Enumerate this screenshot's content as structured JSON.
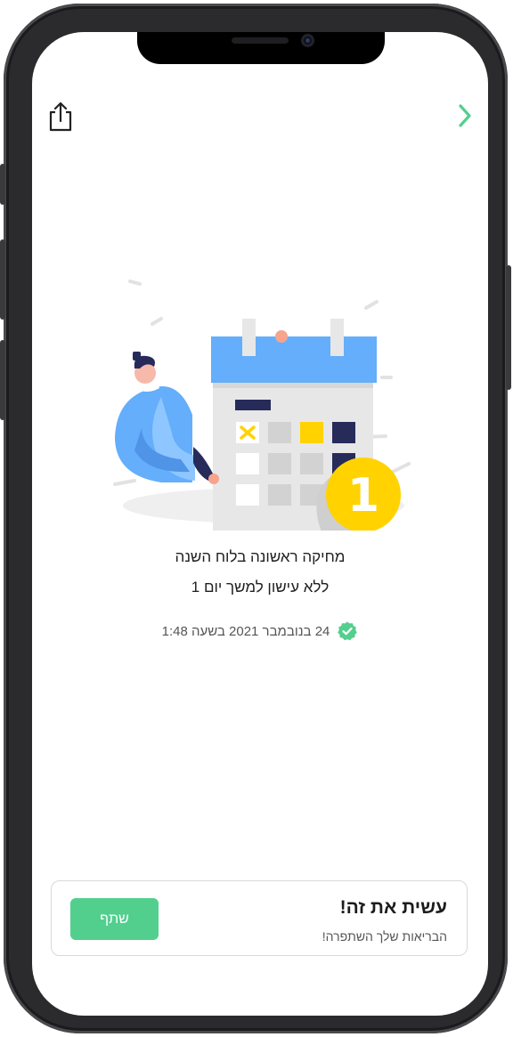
{
  "header": {
    "share_icon": "share-icon",
    "next_icon": "chevron-right-icon"
  },
  "achievement": {
    "badge_number": "1",
    "title": "מחיקה ראשונה בלוח השנה",
    "subtitle": "ללא עישון למשך יום 1",
    "date": "24 בנובמבר 2021 בשעה 1:48",
    "verified_icon": "verified-check-icon"
  },
  "card": {
    "title": "עשית את זה!",
    "subtitle": "הבריאות שלך השתפרה!",
    "share_button_label": "שתף"
  },
  "colors": {
    "accent": "#52cf8d",
    "calendar_header": "#64aefb",
    "badge": "#ffd200",
    "dark_navy": "#262b5a"
  }
}
